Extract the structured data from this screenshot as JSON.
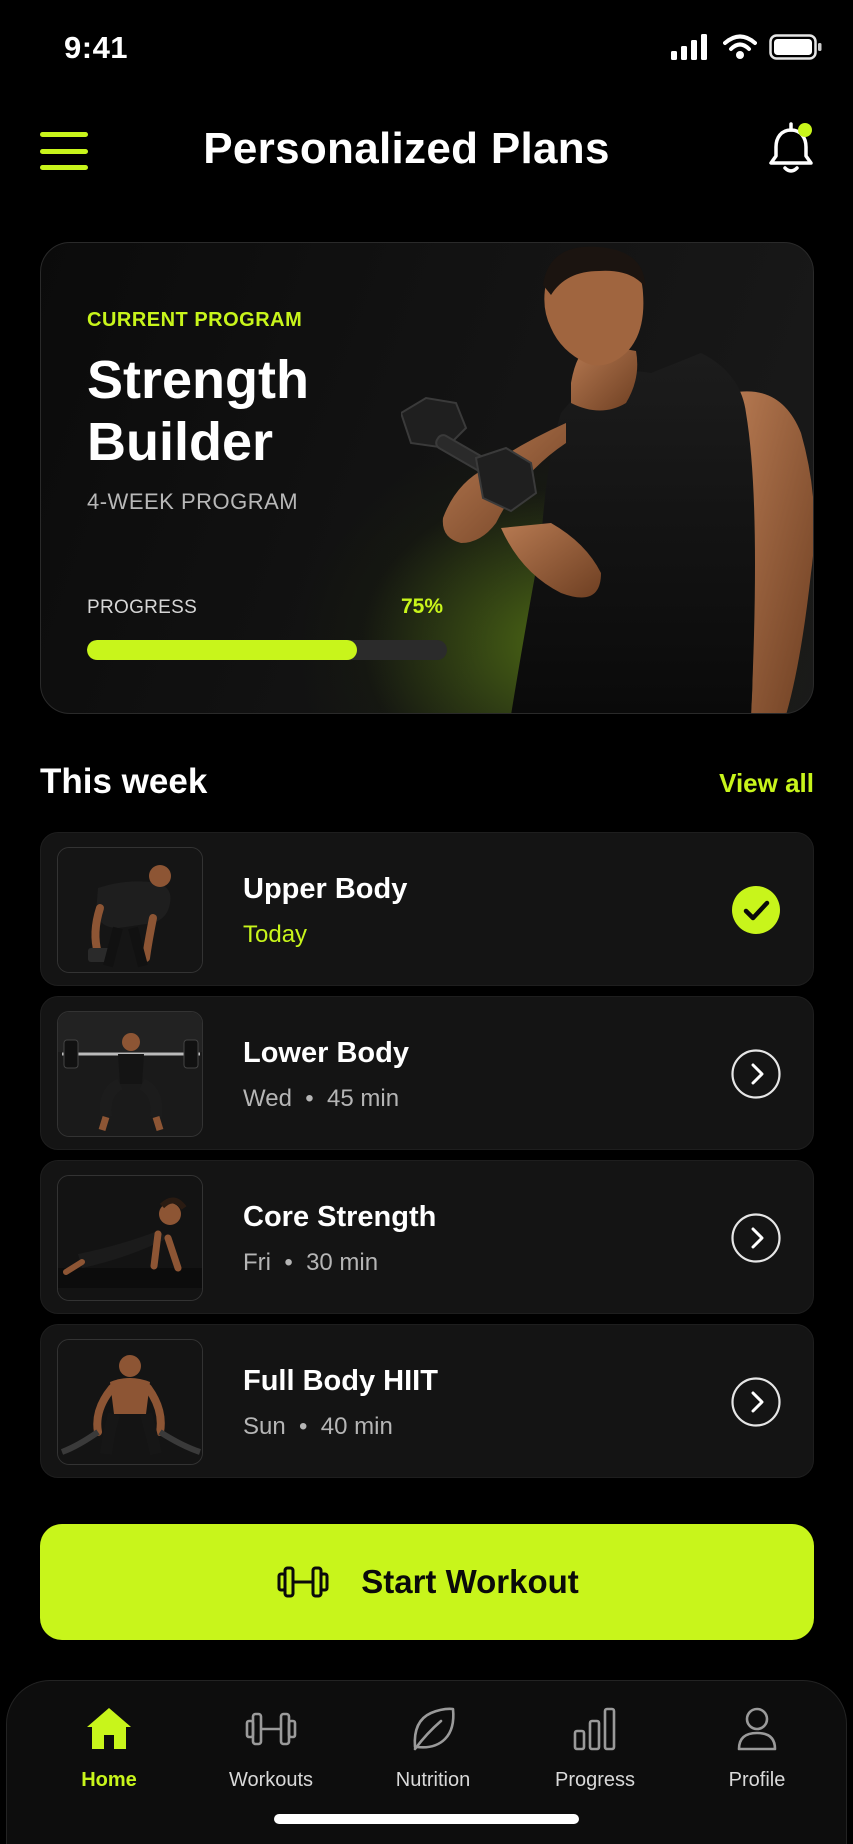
{
  "status": {
    "time": "9:41"
  },
  "header": {
    "title": "Personalized Plans"
  },
  "program": {
    "eyebrow": "CURRENT PROGRAM",
    "title": "Strength Builder",
    "subtitle": "4-WEEK PROGRAM",
    "progress_label": "PROGRESS",
    "progress_text": "75%",
    "progress_value": 0.75
  },
  "week": {
    "title": "This week",
    "view_all": "View all",
    "workouts": [
      {
        "title": "Upper Body",
        "meta": "Today",
        "status": "completed"
      },
      {
        "title": "Lower Body",
        "day": "Wed",
        "duration": "45 min",
        "status": "upcoming"
      },
      {
        "title": "Core Strength",
        "day": "Fri",
        "duration": "30 min",
        "status": "upcoming"
      },
      {
        "title": "Full Body HIIT",
        "day": "Sun",
        "duration": "40 min",
        "status": "upcoming"
      }
    ]
  },
  "cta": {
    "label": "Start Workout",
    "icon": "dumbbell-icon"
  },
  "tabs": [
    {
      "label": "Home",
      "icon": "home-icon",
      "active": true
    },
    {
      "label": "Workouts",
      "icon": "dumbbell-icon",
      "active": false
    },
    {
      "label": "Nutrition",
      "icon": "leaf-icon",
      "active": false
    },
    {
      "label": "Progress",
      "icon": "bar-chart-icon",
      "active": false
    },
    {
      "label": "Profile",
      "icon": "user-icon",
      "active": false
    }
  ],
  "colors": {
    "accent": "#c8f51b",
    "background": "#000000",
    "card": "#141414"
  }
}
